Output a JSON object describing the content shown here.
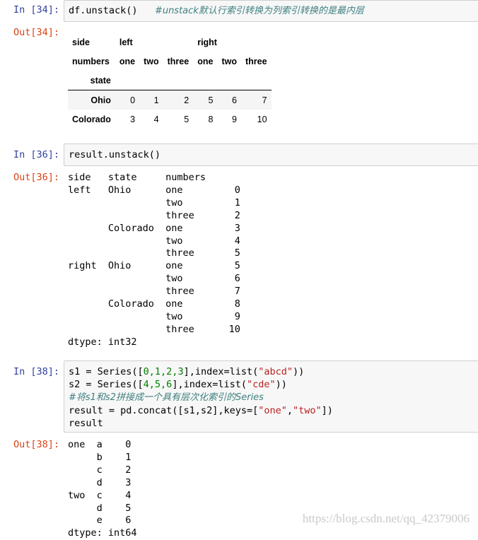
{
  "cells": [
    {
      "in_prompt": "In [34]:",
      "code_main": "df.unstack()",
      "code_comment": "#unstack默认行索引转换为列索引转换的是最内层",
      "out_prompt": "Out[34]:",
      "table": {
        "level1_index_name": "side",
        "level1": [
          "left",
          "right"
        ],
        "level2_index_name": "numbers",
        "level2": [
          "one",
          "two",
          "three",
          "one",
          "two",
          "three"
        ],
        "row_index_name": "state",
        "rows": [
          {
            "label": "Ohio",
            "values": [
              "0",
              "1",
              "2",
              "5",
              "6",
              "7"
            ]
          },
          {
            "label": "Colorado",
            "values": [
              "3",
              "4",
              "5",
              "8",
              "9",
              "10"
            ]
          }
        ]
      }
    },
    {
      "in_prompt": "In [36]:",
      "code": "result.unstack()",
      "out_prompt": "Out[36]:",
      "output_lines": [
        "side   state     numbers",
        "left   Ohio      one         0",
        "                 two         1",
        "                 three       2",
        "       Colorado  one         3",
        "                 two         4",
        "                 three       5",
        "right  Ohio      one         5",
        "                 two         6",
        "                 three       7",
        "       Colorado  one         8",
        "                 two         9",
        "                 three      10",
        "dtype: int32"
      ]
    },
    {
      "in_prompt": "In [38]:",
      "code_lines": {
        "l1_a": "s1 = Series([",
        "l1_n": "0,1,2,3",
        "l1_b": "],index=list(",
        "l1_s": "\"abcd\"",
        "l1_c": "))",
        "l2_a": "s2 = Series([",
        "l2_n": "4,5,6",
        "l2_b": "],index=list(",
        "l2_s": "\"cde\"",
        "l2_c": "))",
        "l3_comment": "#将s1和s2拼接成一个具有层次化索引的Series",
        "l4_a": "result = pd.concat([s1,s2],keys=[",
        "l4_s1": "\"one\"",
        "l4_comma": ",",
        "l4_s2": "\"two\"",
        "l4_c": "])",
        "l5": "result"
      },
      "out_prompt": "Out[38]:",
      "output_lines": [
        "one  a    0",
        "     b    1",
        "     c    2",
        "     d    3",
        "two  c    4",
        "     d    5",
        "     e    6",
        "dtype: int64"
      ]
    }
  ],
  "watermark": "https://blog.csdn.net/qq_42379006"
}
